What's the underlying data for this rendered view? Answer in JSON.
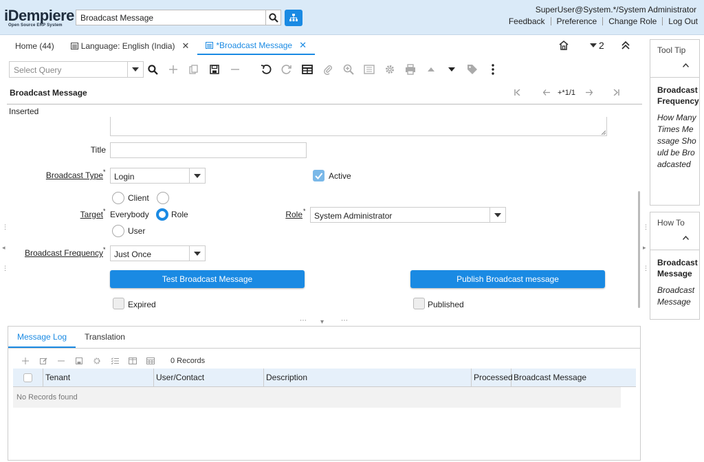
{
  "header": {
    "logo_text": "iDempiere",
    "logo_sub": "Open Source ERP System",
    "search_value": "Broadcast Message",
    "user": "SuperUser@System.*/System Administrator",
    "links": [
      "Feedback",
      "Preference",
      "Change Role",
      "Log Out"
    ]
  },
  "tabs": {
    "home": "Home (44)",
    "language": "Language: English (India)",
    "broadcast": "*Broadcast Message",
    "window_count": "2"
  },
  "toolbar": {
    "select_query_placeholder": "Select Query"
  },
  "window": {
    "title": "Broadcast Message",
    "record_nav": "+*1/1",
    "status": "Inserted"
  },
  "form": {
    "title_label": "Title",
    "title_value": "",
    "broadcast_type_label": "Broadcast Type",
    "broadcast_type_value": "Login",
    "active_label": "Active",
    "active_checked": true,
    "target_label": "Target",
    "target_options": [
      "Client",
      "Everybody",
      "Role",
      "User"
    ],
    "target_selected": "Role",
    "role_label": "Role",
    "role_value": "System Administrator",
    "frequency_label": "Broadcast Frequency",
    "frequency_value": "Just Once",
    "test_button": "Test Broadcast Message",
    "publish_button": "Publish Broadcast message",
    "expired_label": "Expired",
    "published_label": "Published"
  },
  "detail": {
    "tabs": [
      "Message Log",
      "Translation"
    ],
    "records": "0 Records",
    "columns": [
      "Tenant",
      "User/Contact",
      "Description",
      "Processed",
      "Broadcast Message"
    ],
    "empty": "No Records found"
  },
  "sidebar": {
    "tooltip_title": "Tool Tip",
    "tooltip_heading": "Broadcast Frequency",
    "tooltip_body": "How Many Times Message Should be Broadcasted",
    "howto_title": "How To",
    "howto_heading": "Broadcast Message",
    "howto_body": "Broadcast Message"
  },
  "colors": {
    "accent": "#1a8ae3",
    "header_bg": "#daeaf8"
  }
}
